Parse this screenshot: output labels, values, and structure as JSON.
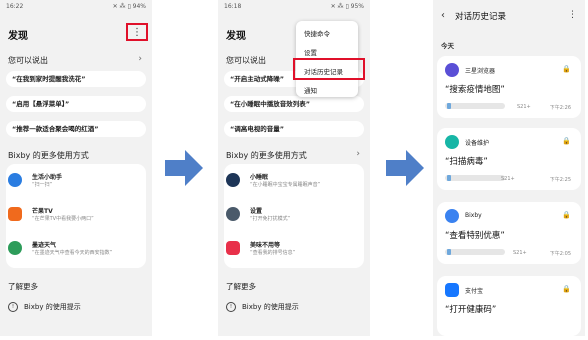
{
  "screen1": {
    "status_time": "16:22",
    "status_icons": "✕ ⁂ ▯ 94%",
    "title": "发现",
    "more_glyph": "⋮",
    "section_say": "您可以说出",
    "chevron": "›",
    "pills": [
      "“在我到家时提醒我洗花”",
      "“启用【悬浮菜单】”",
      "“推荐一款适合聚会喝的红酒”"
    ],
    "bixby_head": "Bixby 的更多使用方式",
    "apps": [
      {
        "name": "生活小助手",
        "desc": "“扫一扫”",
        "color": "#2a7de1"
      },
      {
        "name": "芒果TV",
        "desc": "“在芒果TV中看我要小两口”",
        "color": "#f06a1d"
      },
      {
        "name": "墨迹天气",
        "desc": "“在墨迹天气中查看今天的西安指数”",
        "color": "#2d9c5a"
      }
    ],
    "learn_more": "了解更多",
    "tip": "Bixby 的使用提示",
    "tip_icon": "!"
  },
  "screen2": {
    "status_time": "16:18",
    "status_icons": "✕ ⁂ ▯ 95%",
    "title": "发现",
    "section_say": "您可以说出",
    "pills": [
      "“开启主动式降噪”",
      "“在小睡眠中播放音效列表”",
      "“调高电视的音量”"
    ],
    "bixby_head": "Bixby 的更多使用方式",
    "chevron": "›",
    "apps": [
      {
        "name": "小睡眠",
        "desc": "“在小睡眠中宝宝专属睡眠声音”",
        "color": "#1d3557"
      },
      {
        "name": "设置",
        "desc": "“打开免打扰模式”",
        "color": "#4a5a6a"
      },
      {
        "name": "美味不用等",
        "desc": "“查看我的排号信息”",
        "color": "#e8304a"
      }
    ],
    "learn_more": "了解更多",
    "tip": "Bixby 的使用提示",
    "tip_icon": "!",
    "menu": [
      "快捷命令",
      "设置",
      "对话历史记录",
      "通知"
    ]
  },
  "screen3": {
    "back_glyph": "‹",
    "title": "对话历史记录",
    "more_glyph": "⋮",
    "day": "今天",
    "lock_glyph": "🔒",
    "cards": [
      {
        "app": "三星浏览器",
        "query": "“搜索疫情地图”",
        "device": "S21+",
        "time": "下午2:26",
        "color": "#5a4fd6"
      },
      {
        "app": "设备维护",
        "query": "“扫描病毒”",
        "device": "S21+",
        "time": "下午2:25",
        "color": "#17b6a6"
      },
      {
        "app": "Bixby",
        "query": "“查看特别优惠”",
        "device": "S21+",
        "time": "下午2:05",
        "color": "#3a82f0"
      },
      {
        "app": "支付宝",
        "query": "“打开健康码”",
        "device": "",
        "time": "",
        "color": "#1677ff"
      }
    ]
  },
  "colors": {
    "highlight": "#e0102a",
    "arrow": "#4f7fc8"
  }
}
